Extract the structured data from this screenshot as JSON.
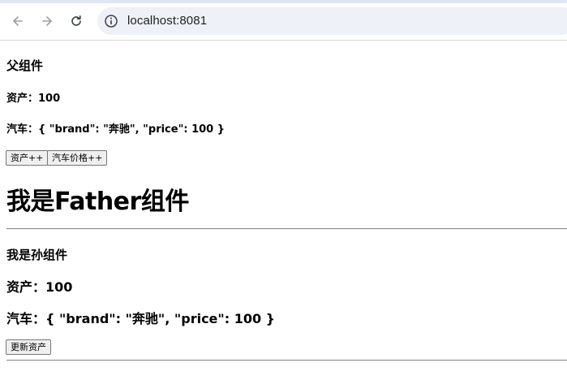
{
  "browser": {
    "url": "localhost:8081"
  },
  "parent": {
    "title": "父组件",
    "assets_line": "资产：100",
    "car_line": "汽车：{ \"brand\": \"奔驰\", \"price\": 100 }",
    "buttons": {
      "assets_inc": "资产++",
      "car_price_inc": "汽车价格++"
    }
  },
  "father": {
    "title": "我是Father组件"
  },
  "grandchild": {
    "title": "我是孙组件",
    "assets_line": "资产：100",
    "car_line": "汽车：{ \"brand\": \"奔驰\", \"price\": 100 }",
    "update_button": "更新资产"
  }
}
